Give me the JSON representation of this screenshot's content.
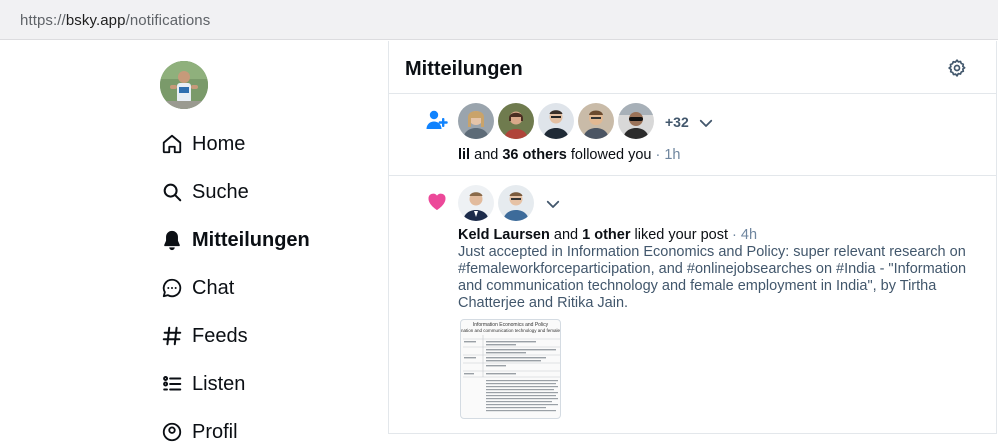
{
  "browser": {
    "url_scheme": "https://",
    "url_host": "bsky.app",
    "url_path": "/notifications"
  },
  "sidebar": {
    "items": [
      {
        "label": "Home",
        "icon": "home-icon"
      },
      {
        "label": "Suche",
        "icon": "search-icon"
      },
      {
        "label": "Mitteilungen",
        "icon": "bell-icon",
        "active": true
      },
      {
        "label": "Chat",
        "icon": "chat-icon"
      },
      {
        "label": "Feeds",
        "icon": "hash-icon"
      },
      {
        "label": "Listen",
        "icon": "list-icon"
      },
      {
        "label": "Profil",
        "icon": "profile-icon"
      }
    ]
  },
  "main": {
    "title": "Mitteilungen",
    "notifications": [
      {
        "type": "follow",
        "icon": "person-add-icon",
        "more_count": "+32",
        "actor": "lil",
        "connector": "and",
        "others": "36 others",
        "action": "followed you",
        "time": "· 1h"
      },
      {
        "type": "like",
        "icon": "heart-icon",
        "actor": "Keld Laursen",
        "connector": "and",
        "others": "1 other",
        "action": "liked your post",
        "time": "· 4h",
        "post_text": "Just accepted in Information Economics and Policy: super relevant research on #femaleworkforceparticipation, and #onlinejobsearches on #India - \"Information and communication technology and female employment in India\", by Tirtha Chatterjee and Ritika Jain.",
        "image_title": "Information Economics and Policy",
        "image_subtitle": "nation and communication technology and female employment in I"
      }
    ]
  },
  "colors": {
    "accent_blue": "#1083fe",
    "like_pink": "#ec4899",
    "muted": "#6f869f",
    "divider": "#e3e7eb"
  }
}
